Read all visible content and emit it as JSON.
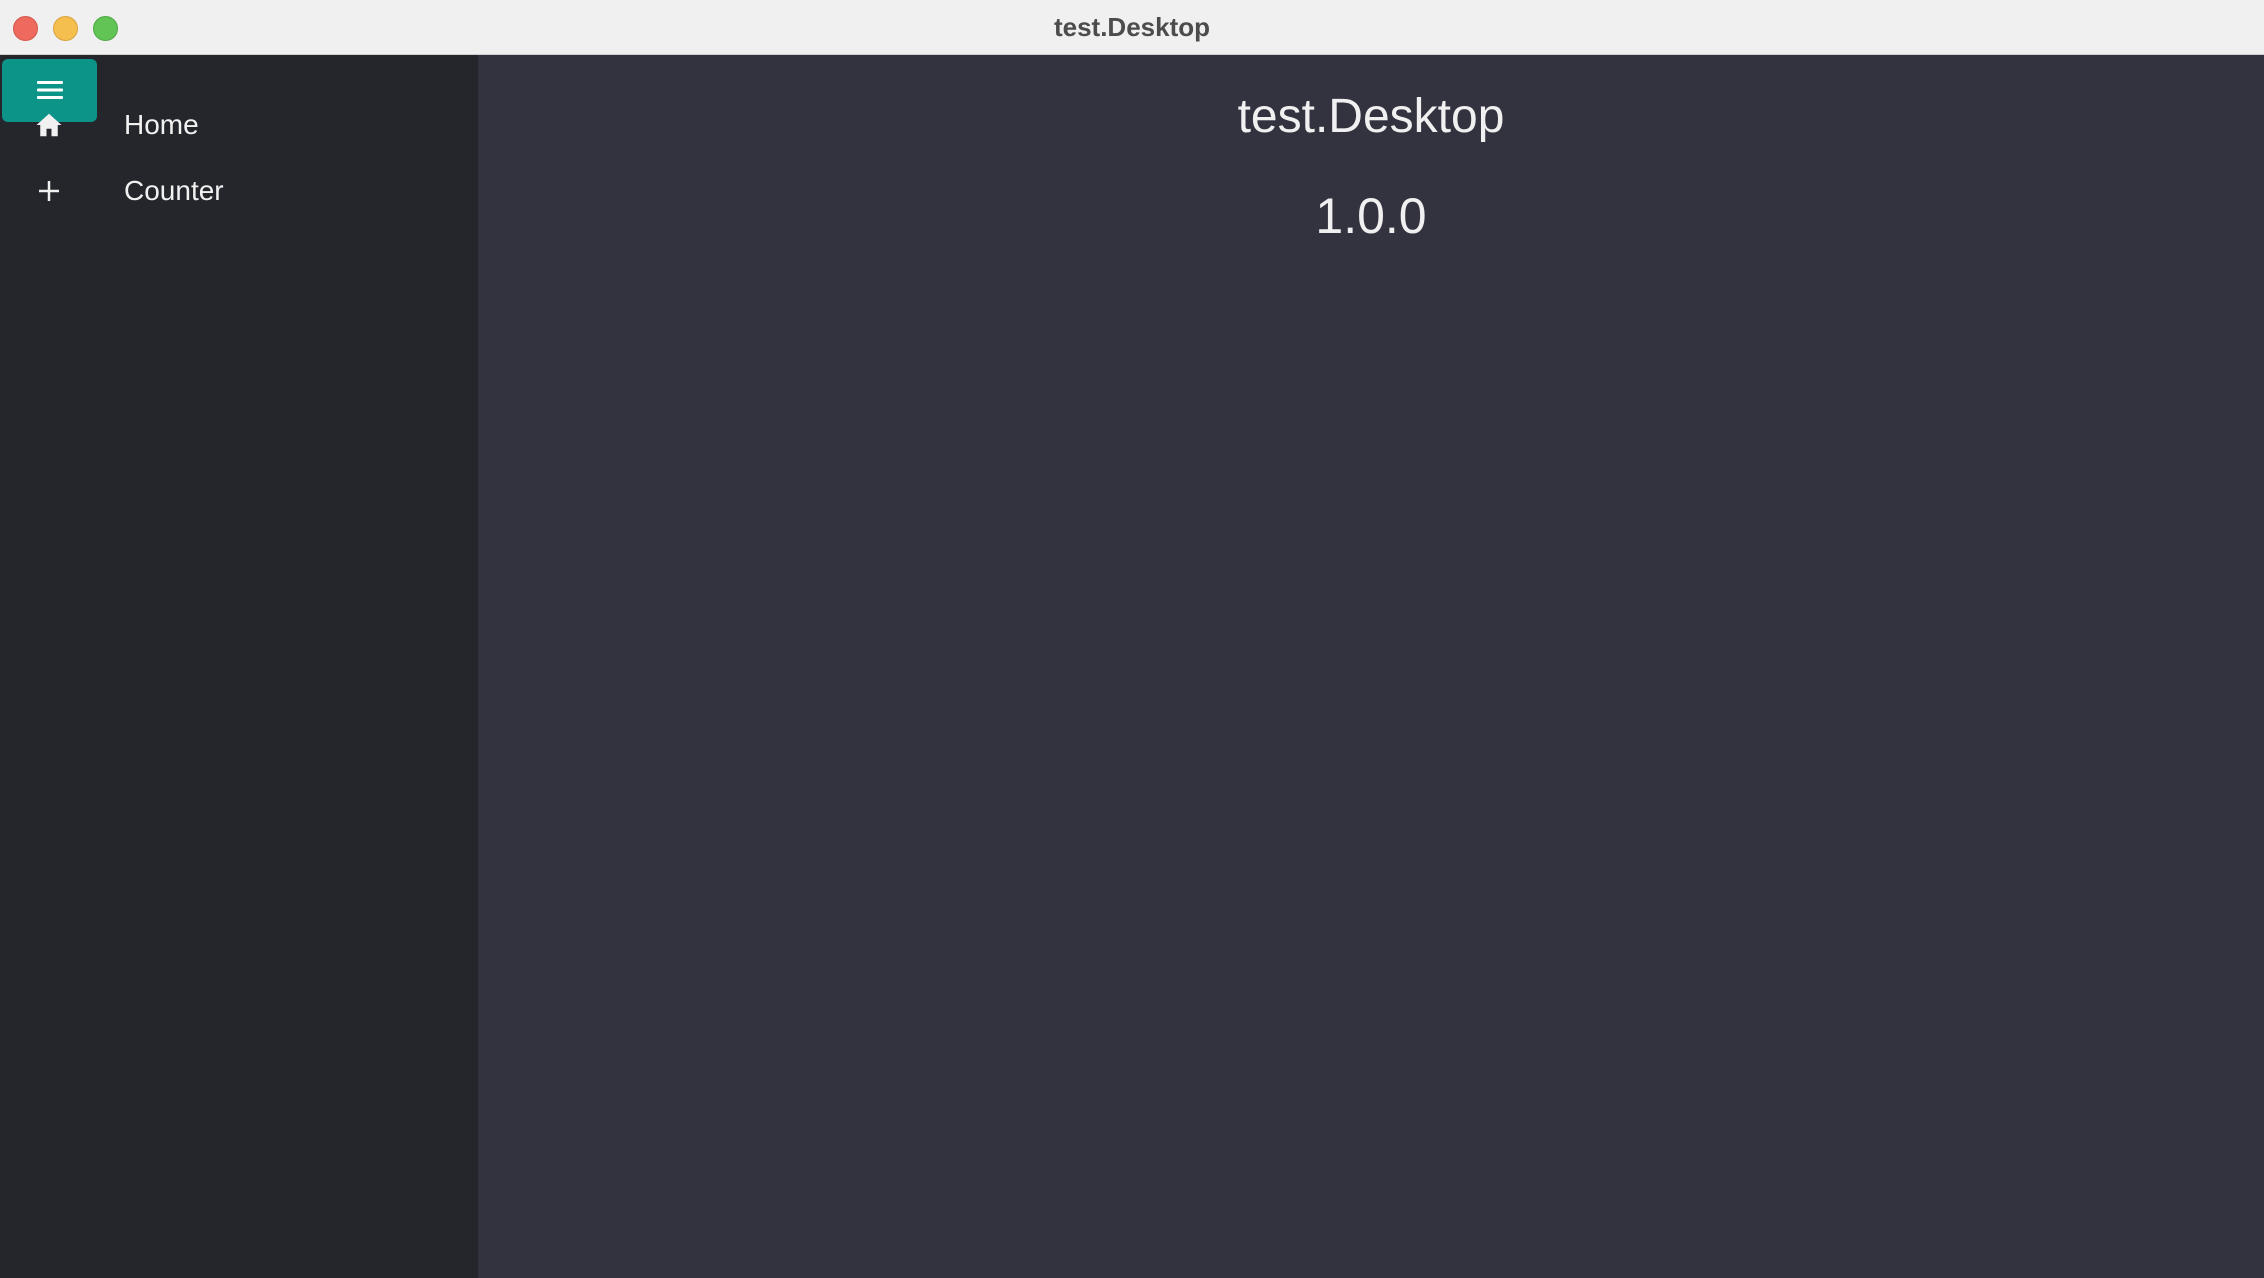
{
  "window": {
    "title": "test.Desktop"
  },
  "sidebar": {
    "menu_icon": "hamburger-menu-icon",
    "accent_color": "#0d9488",
    "items": [
      {
        "label": "Home",
        "icon": "home-icon"
      },
      {
        "label": "Counter",
        "icon": "plus-icon"
      }
    ]
  },
  "main": {
    "heading": "test.Desktop",
    "version": "1.0.0"
  }
}
